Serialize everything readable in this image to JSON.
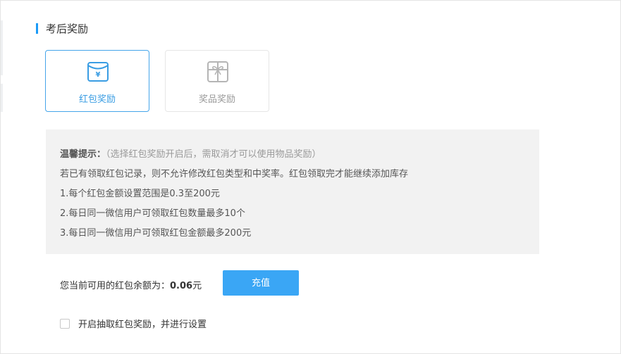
{
  "section": {
    "title": "考后奖励"
  },
  "reward_types": [
    {
      "label": "红包奖励",
      "icon": "red-envelope-icon",
      "selected": true
    },
    {
      "label": "奖品奖励",
      "icon": "gift-box-icon",
      "selected": false
    }
  ],
  "tips": {
    "title": "温馨提示：",
    "note": "（选择红包奖励开启后，需取消才可以使用物品奖励）",
    "lines": [
      "若已有领取红包记录，则不允许修改红包类型和中奖率。红包领取完才能继续添加库存",
      "1.每个红包金额设置范围是0.3至200元",
      "2.每日同一微信用户可领取红包数量最多10个",
      "3.每日同一微信用户可领取红包金额最多200元"
    ]
  },
  "balance": {
    "label": "您当前可用的红包余额为：",
    "amount": "0.06",
    "unit": "元",
    "recharge_label": "充值"
  },
  "enable_option": {
    "label": "开启抽取红包奖励，并进行设置",
    "checked": false
  },
  "colors": {
    "accent": "#3aa6f5",
    "selected_border": "#45a5ea",
    "tips_background": "#f2f2f2"
  }
}
